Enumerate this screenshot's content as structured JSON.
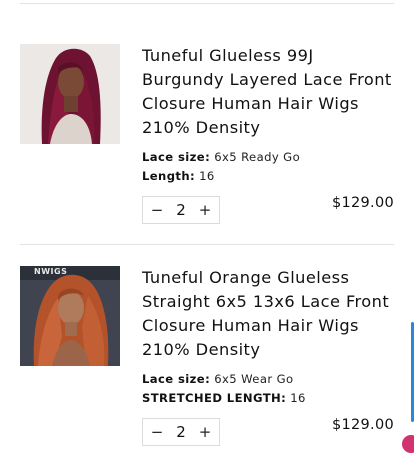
{
  "cart": {
    "items": [
      {
        "title": "Tuneful Glueless 99J Burgundy Layered Lace Front Closure Human Hair Wigs 210% Density",
        "attrs": [
          {
            "label": "Lace size:",
            "value": "6x5 Ready Go"
          },
          {
            "label": "Length:",
            "value": "16"
          }
        ],
        "quantity": "2",
        "price": "$129.00",
        "image_alt": "burgundy-wig-photo"
      },
      {
        "title": "Tuneful Orange Glueless Straight 6x5 13x6 Lace Front Closure Human Hair Wigs 210% Density",
        "attrs": [
          {
            "label": "Lace size:",
            "value": "6x5 Wear Go"
          },
          {
            "label": "STRETCHED LENGTH:",
            "value": "16"
          }
        ],
        "quantity": "2",
        "price": "$129.00",
        "image_alt": "orange-wig-photo",
        "image_caption": "NWIGS"
      }
    ],
    "qty_minus": "−",
    "qty_plus": "+"
  },
  "colors": {
    "divider": "#e3e3e3",
    "scroll_accent": "#2c87d8"
  }
}
